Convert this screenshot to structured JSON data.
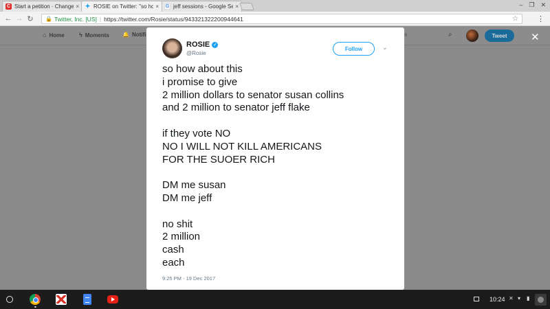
{
  "browser": {
    "tabs": [
      {
        "title": "Start a petition · Change",
        "favicon_label": "C",
        "favicon_color": "#e12d2b",
        "active": false
      },
      {
        "title": "ROSIE on Twitter: \"so ho",
        "favicon_label": "",
        "favicon_color": "#1da1f2",
        "active": true
      },
      {
        "title": "jeff sessions - Google Se",
        "favicon_label": "G",
        "favicon_color": "#4285f4",
        "active": false
      }
    ],
    "close_glyph": "×",
    "window_controls": {
      "minimize": "–",
      "maximize": "❐",
      "close": "✕"
    },
    "back_icon": "←",
    "forward_icon": "→",
    "reload_icon": "↻",
    "secure_label": "Twitter, Inc. [US]",
    "url": "https://twitter.com/Rosie/status/943321322200944641",
    "url_divider": "|",
    "bookmark_icon": "☆",
    "menu_icon": "⋮"
  },
  "twitter_nav": {
    "home": "Home",
    "moments": "Moments",
    "notifications": "Notifi",
    "search_placeholder": "e",
    "tweet_button": "Tweet",
    "close": "✕",
    "home_icon": "⌂",
    "moments_icon": "ϟ",
    "bell_icon": "🔔",
    "search_icon": "⌕"
  },
  "tweet": {
    "user": "ROSIE",
    "verified_glyph": "✓",
    "handle": "@Rosie",
    "follow_label": "Follow",
    "caret": "⌄",
    "lines": [
      "so how about this",
      "i promise to give",
      "2 million dollars to senator susan collins",
      "and 2 million to senator jeff flake",
      "",
      "if they vote NO",
      "NO I WILL NOT KILL AMERICANS",
      "FOR THE SUOER RICH",
      "",
      "DM me susan",
      "DM me jeff",
      "",
      "no shit",
      "2 million",
      "cash",
      "each"
    ],
    "timestamp": "9:25 PM - 19 Dec 2017"
  },
  "shelf": {
    "apps": [
      "chrome-icon",
      "gmail-icon",
      "docs-icon",
      "youtube-icon"
    ],
    "time": "10:24",
    "mute_icon": "✕",
    "wifi_icon": "▾",
    "battery_icon": "▮"
  },
  "colors": {
    "twitter_blue": "#1da1f2",
    "overlay_gray": "#8a8a8a",
    "secure_green": "#1e8e3e"
  }
}
